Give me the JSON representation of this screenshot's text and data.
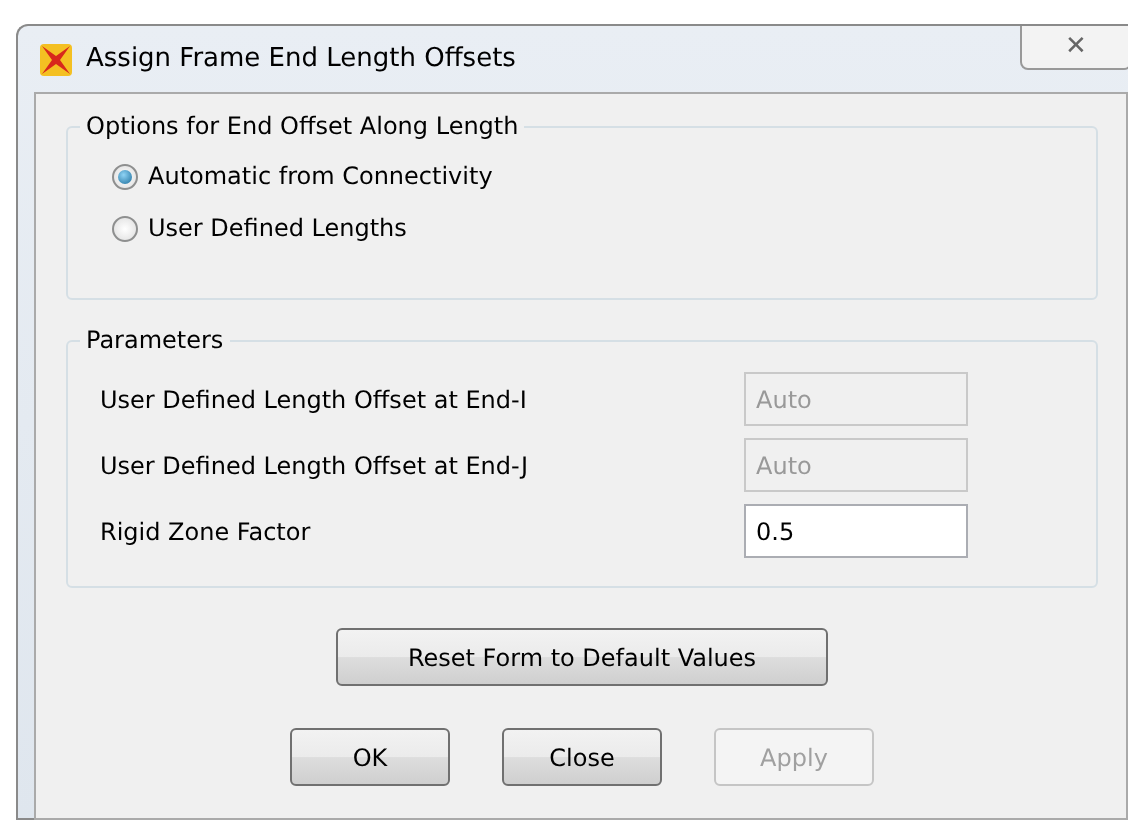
{
  "window": {
    "title": "Assign Frame End Length Offsets",
    "close_label": "✕"
  },
  "options_group": {
    "title": "Options for End Offset Along Length",
    "options": [
      {
        "label": "Automatic from Connectivity",
        "selected": true
      },
      {
        "label": "User Defined Lengths",
        "selected": false
      }
    ]
  },
  "parameters_group": {
    "title": "Parameters",
    "fields": [
      {
        "label": "User Defined Length Offset at End-I",
        "value": "Auto",
        "disabled": true
      },
      {
        "label": "User Defined Length Offset at End-J",
        "value": "Auto",
        "disabled": true
      },
      {
        "label": "Rigid Zone Factor",
        "value": "0.5",
        "disabled": false
      }
    ]
  },
  "reset_button": {
    "label": "Reset Form to Default Values"
  },
  "buttons": [
    {
      "label": "OK",
      "disabled": false
    },
    {
      "label": "Close",
      "disabled": false
    },
    {
      "label": "Apply",
      "disabled": true
    }
  ]
}
